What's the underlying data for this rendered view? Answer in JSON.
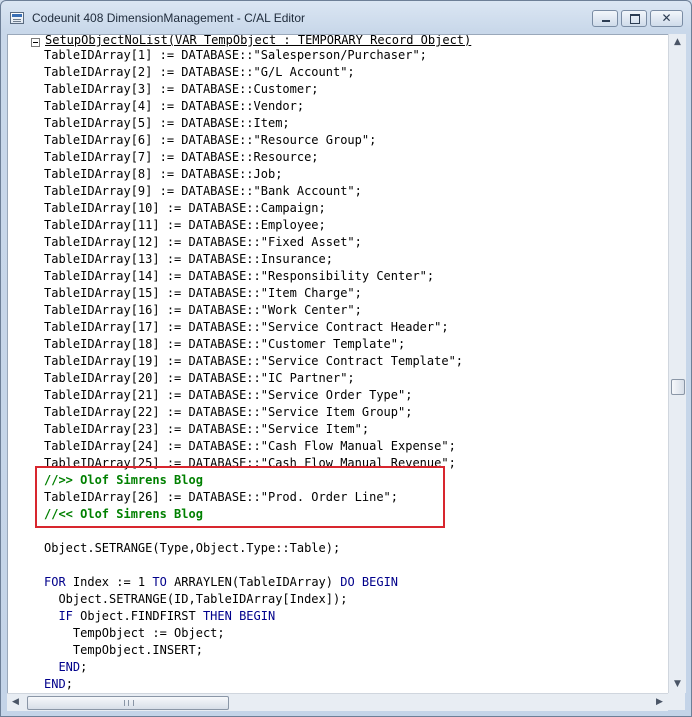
{
  "window": {
    "title": "Codeunit 408 DimensionManagement - C/AL Editor",
    "minimize_icon": "minimize-icon",
    "maximize_icon": "maximize-icon",
    "close_label": "✕"
  },
  "editor": {
    "procedure_header": "SetupObjectNoList(VAR TempObject : TEMPORARY Record Object)",
    "lines": [
      {
        "segments": [
          {
            "text": "TableIDArray[1] := DATABASE::\"Salesperson/Purchaser\";",
            "style": "plain"
          }
        ]
      },
      {
        "segments": [
          {
            "text": "TableIDArray[2] := DATABASE::\"G/L Account\";",
            "style": "plain"
          }
        ]
      },
      {
        "segments": [
          {
            "text": "TableIDArray[3] := DATABASE::Customer;",
            "style": "plain"
          }
        ]
      },
      {
        "segments": [
          {
            "text": "TableIDArray[4] := DATABASE::Vendor;",
            "style": "plain"
          }
        ]
      },
      {
        "segments": [
          {
            "text": "TableIDArray[5] := DATABASE::Item;",
            "style": "plain"
          }
        ]
      },
      {
        "segments": [
          {
            "text": "TableIDArray[6] := DATABASE::\"Resource Group\";",
            "style": "plain"
          }
        ]
      },
      {
        "segments": [
          {
            "text": "TableIDArray[7] := DATABASE::Resource;",
            "style": "plain"
          }
        ]
      },
      {
        "segments": [
          {
            "text": "TableIDArray[8] := DATABASE::Job;",
            "style": "plain"
          }
        ]
      },
      {
        "segments": [
          {
            "text": "TableIDArray[9] := DATABASE::\"Bank Account\";",
            "style": "plain"
          }
        ]
      },
      {
        "segments": [
          {
            "text": "TableIDArray[10] := DATABASE::Campaign;",
            "style": "plain"
          }
        ]
      },
      {
        "segments": [
          {
            "text": "TableIDArray[11] := DATABASE::Employee;",
            "style": "plain"
          }
        ]
      },
      {
        "segments": [
          {
            "text": "TableIDArray[12] := DATABASE::\"Fixed Asset\";",
            "style": "plain"
          }
        ]
      },
      {
        "segments": [
          {
            "text": "TableIDArray[13] := DATABASE::Insurance;",
            "style": "plain"
          }
        ]
      },
      {
        "segments": [
          {
            "text": "TableIDArray[14] := DATABASE::\"Responsibility Center\";",
            "style": "plain"
          }
        ]
      },
      {
        "segments": [
          {
            "text": "TableIDArray[15] := DATABASE::\"Item Charge\";",
            "style": "plain"
          }
        ]
      },
      {
        "segments": [
          {
            "text": "TableIDArray[16] := DATABASE::\"Work Center\";",
            "style": "plain"
          }
        ]
      },
      {
        "segments": [
          {
            "text": "TableIDArray[17] := DATABASE::\"Service Contract Header\";",
            "style": "plain"
          }
        ]
      },
      {
        "segments": [
          {
            "text": "TableIDArray[18] := DATABASE::\"Customer Template\";",
            "style": "plain"
          }
        ]
      },
      {
        "segments": [
          {
            "text": "TableIDArray[19] := DATABASE::\"Service Contract Template\";",
            "style": "plain"
          }
        ]
      },
      {
        "segments": [
          {
            "text": "TableIDArray[20] := DATABASE::\"IC Partner\";",
            "style": "plain"
          }
        ]
      },
      {
        "segments": [
          {
            "text": "TableIDArray[21] := DATABASE::\"Service Order Type\";",
            "style": "plain"
          }
        ]
      },
      {
        "segments": [
          {
            "text": "TableIDArray[22] := DATABASE::\"Service Item Group\";",
            "style": "plain"
          }
        ]
      },
      {
        "segments": [
          {
            "text": "TableIDArray[23] := DATABASE::\"Service Item\";",
            "style": "plain"
          }
        ]
      },
      {
        "segments": [
          {
            "text": "TableIDArray[24] := DATABASE::\"Cash Flow Manual Expense\";",
            "style": "plain"
          }
        ]
      },
      {
        "segments": [
          {
            "text": "TableIDArray[25] := DATABASE::\"Cash Flow Manual Revenue\";",
            "style": "plain"
          }
        ]
      },
      {
        "segments": [
          {
            "text": "//>> Olof Simrens Blog",
            "style": "comment"
          }
        ]
      },
      {
        "segments": [
          {
            "text": "TableIDArray[26] := DATABASE::\"Prod. Order Line\";",
            "style": "plain"
          }
        ]
      },
      {
        "segments": [
          {
            "text": "//<< Olof Simrens Blog",
            "style": "comment"
          }
        ]
      },
      {
        "segments": []
      },
      {
        "segments": [
          {
            "text": "Object.SETRANGE(Type,Object.Type::Table);",
            "style": "plain"
          }
        ]
      },
      {
        "segments": []
      },
      {
        "segments": [
          {
            "text": "FOR",
            "style": "keyword"
          },
          {
            "text": " Index := 1 ",
            "style": "plain"
          },
          {
            "text": "TO",
            "style": "keyword"
          },
          {
            "text": " ARRAYLEN(TableIDArray) ",
            "style": "plain"
          },
          {
            "text": "DO BEGIN",
            "style": "keyword"
          }
        ]
      },
      {
        "segments": [
          {
            "text": "  Object.SETRANGE(ID,TableIDArray[Index]);",
            "style": "plain"
          }
        ]
      },
      {
        "segments": [
          {
            "text": "  ",
            "style": "plain"
          },
          {
            "text": "IF",
            "style": "keyword"
          },
          {
            "text": " Object.FINDFIRST ",
            "style": "plain"
          },
          {
            "text": "THEN BEGIN",
            "style": "keyword"
          }
        ]
      },
      {
        "segments": [
          {
            "text": "    TempObject := Object;",
            "style": "plain"
          }
        ]
      },
      {
        "segments": [
          {
            "text": "    TempObject.INSERT;",
            "style": "plain"
          }
        ]
      },
      {
        "segments": [
          {
            "text": "  ",
            "style": "plain"
          },
          {
            "text": "END",
            "style": "keyword"
          },
          {
            "text": ";",
            "style": "plain"
          }
        ]
      },
      {
        "segments": [
          {
            "text": "END",
            "style": "keyword"
          },
          {
            "text": ";",
            "style": "plain"
          }
        ]
      }
    ]
  },
  "colors": {
    "comment": "#008000",
    "keyword": "#00008b",
    "highlight_border": "#d8262e"
  },
  "icons": {
    "app": "cal-editor-icon",
    "collapse": "collapse-minus-icon",
    "scroll_up": "arrow-up-icon",
    "scroll_down": "arrow-down-icon",
    "scroll_left": "arrow-left-icon",
    "scroll_right": "arrow-right-icon"
  }
}
